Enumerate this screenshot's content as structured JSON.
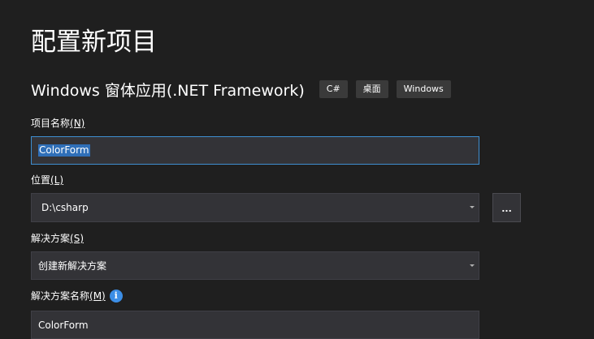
{
  "page_title": "配置新项目",
  "template": {
    "name": "Windows 窗体应用(.NET Framework)",
    "tags": [
      "C#",
      "桌面",
      "Windows"
    ]
  },
  "project_name": {
    "label": "项目名称",
    "mnemonic": "(N)",
    "value": "ColorForm"
  },
  "location": {
    "label": "位置",
    "mnemonic": "(L)",
    "value": "D:\\csharp",
    "browse_label": "..."
  },
  "solution": {
    "label": "解决方案",
    "mnemonic": "(S)",
    "value": "创建新解决方案"
  },
  "solution_name": {
    "label": "解决方案名称",
    "mnemonic": "(M)",
    "info_icon": "i",
    "value": "ColorForm"
  }
}
